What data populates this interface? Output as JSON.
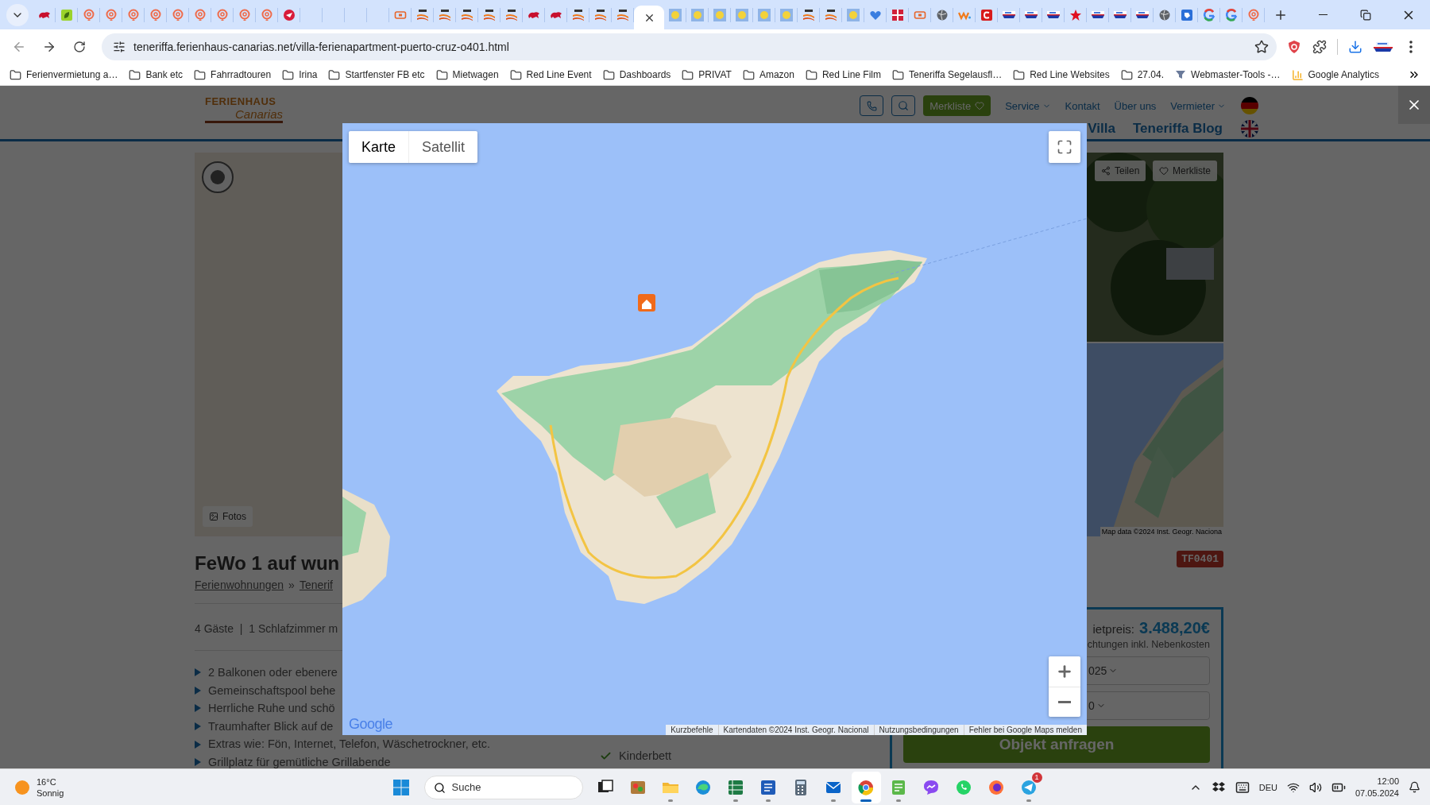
{
  "browser": {
    "tabs": [
      {
        "selected": false
      },
      {
        "selected": false
      },
      {
        "selected": false
      },
      {
        "selected": false
      },
      {
        "selected": false
      },
      {
        "selected": false
      },
      {
        "selected": false
      },
      {
        "selected": false
      },
      {
        "selected": false
      },
      {
        "selected": false
      },
      {
        "selected": false
      },
      {
        "selected": false
      },
      {
        "selected": false
      },
      {
        "selected": false
      },
      {
        "selected": false
      },
      {
        "selected": false
      },
      {
        "selected": false
      },
      {
        "selected": false
      },
      {
        "selected": false
      },
      {
        "selected": false
      },
      {
        "selected": false
      },
      {
        "selected": false
      },
      {
        "selected": false
      },
      {
        "selected": false
      },
      {
        "selected": false
      },
      {
        "selected": false
      },
      {
        "selected": false
      },
      {
        "selected": true
      },
      {
        "selected": false
      },
      {
        "selected": false
      },
      {
        "selected": false
      },
      {
        "selected": false
      },
      {
        "selected": false
      },
      {
        "selected": false
      },
      {
        "selected": false
      },
      {
        "selected": false
      },
      {
        "selected": false
      },
      {
        "selected": false
      },
      {
        "selected": false
      },
      {
        "selected": false
      },
      {
        "selected": false
      },
      {
        "selected": false
      },
      {
        "selected": false
      },
      {
        "selected": false
      },
      {
        "selected": false
      },
      {
        "selected": false
      },
      {
        "selected": false
      },
      {
        "selected": false
      },
      {
        "selected": false
      },
      {
        "selected": false
      },
      {
        "selected": false
      },
      {
        "selected": false
      },
      {
        "selected": false
      },
      {
        "selected": false
      },
      {
        "selected": false
      }
    ],
    "address": "teneriffa.ferienhaus-canarias.net/villa-ferienapartment-puerto-cruz-o401.html",
    "bookmarks": [
      {
        "label": "Ferienvermietung a…",
        "kind": "folder"
      },
      {
        "label": "Bank etc",
        "kind": "folder"
      },
      {
        "label": "Fahrradtouren",
        "kind": "folder"
      },
      {
        "label": "Irina",
        "kind": "folder"
      },
      {
        "label": "Startfenster FB etc",
        "kind": "folder"
      },
      {
        "label": "Mietwagen",
        "kind": "folder"
      },
      {
        "label": "Red Line Event",
        "kind": "folder"
      },
      {
        "label": "Dashboards",
        "kind": "folder"
      },
      {
        "label": "PRIVAT",
        "kind": "folder"
      },
      {
        "label": "Amazon",
        "kind": "folder"
      },
      {
        "label": "Red Line Film",
        "kind": "folder"
      },
      {
        "label": "Teneriffa Segelausfl…",
        "kind": "folder"
      },
      {
        "label": "Red Line Websites",
        "kind": "folder"
      },
      {
        "label": "27.04.",
        "kind": "folder"
      },
      {
        "label": "Webmaster-Tools -…",
        "kind": "site"
      },
      {
        "label": "Google Analytics",
        "kind": "analytics"
      }
    ]
  },
  "site": {
    "logo": {
      "line_1": "FERIENHAUS",
      "line_2": "Canarias"
    },
    "watchlist_button": "Merkliste",
    "nav_links": [
      {
        "label": "Service",
        "dropdown": true
      },
      {
        "label": "Kontakt",
        "dropdown": false
      },
      {
        "label": "Über uns",
        "dropdown": false
      },
      {
        "label": "Vermieter",
        "dropdown": true
      }
    ],
    "secondary_links": [
      "Villa",
      "Teneriffa Blog"
    ],
    "gallery": {
      "photos_button": "Fotos",
      "share_button": "Teilen",
      "watchlist_button": "Merkliste",
      "map_attribution": "Map data ©2024 Inst. Geogr. Naciona"
    },
    "listing": {
      "title": "FeWo 1 auf wun",
      "breadcrumbs": [
        "Ferienwohnungen",
        "Tenerif"
      ],
      "breadcrumb_separator": "»",
      "facts": "4 Gäste  |  1 Schlafzimmer m",
      "highlights": [
        "2 Balkonen oder ebenere",
        "Gemeinschaftspool behe",
        "Herrliche Ruhe und schö",
        "Traumhafter Blick auf de",
        "Extras wie: Fön, Internet, Telefon, Wäschetrockner, etc.",
        "Grillplatz für gemütliche Grillabende"
      ],
      "features": [
        "Kinderbett"
      ],
      "code": "TF0401",
      "price": {
        "label": "ietpreis:",
        "amount": "3.488,20€",
        "note": "chtungen inkl. Nebenkosten"
      },
      "selects": [
        "025",
        "0"
      ],
      "request_button": "Objekt anfragen"
    }
  },
  "map_dialog": {
    "map_types": [
      {
        "label": "Karte",
        "selected": true
      },
      {
        "label": "Satellit",
        "selected": false
      }
    ],
    "logo": "Google",
    "attribution": [
      "Kurzbefehle",
      "Kartendaten ©2024 Inst. Geogr. Nacional",
      "Nutzungsbedingungen",
      "Fehler bei Google Maps melden"
    ]
  },
  "taskbar": {
    "weather": {
      "temperature": "16°C",
      "condition": "Sonnig"
    },
    "search": {
      "placeholder": "Suche"
    },
    "apps": [
      {
        "running": false,
        "selected": false
      },
      {
        "running": false,
        "selected": false
      },
      {
        "running": true,
        "selected": false
      },
      {
        "running": false,
        "selected": false
      },
      {
        "running": true,
        "selected": false
      },
      {
        "running": true,
        "selected": false
      },
      {
        "running": false,
        "selected": false
      },
      {
        "running": true,
        "selected": false
      },
      {
        "running": true,
        "selected": true
      },
      {
        "running": true,
        "selected": false
      },
      {
        "running": false,
        "selected": false
      },
      {
        "running": false,
        "selected": false
      },
      {
        "running": false,
        "selected": false
      },
      {
        "running": true,
        "selected": false,
        "badge": "1"
      }
    ],
    "language": "DEU",
    "time": "12:00",
    "date": "07.05.2024"
  }
}
